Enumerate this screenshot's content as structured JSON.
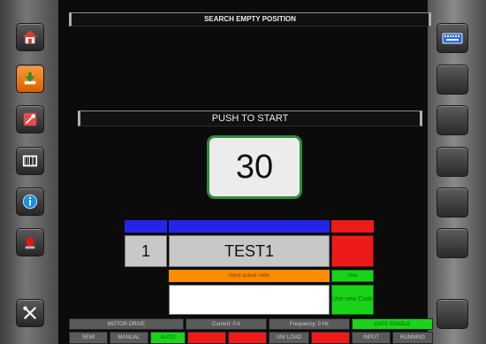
{
  "header": {
    "title": "SEARCH EMPTY POSITION"
  },
  "push": {
    "label": "PUSH TO START"
  },
  "counter": {
    "value": "30"
  },
  "code_panel": {
    "position_header": "",
    "code_header": "",
    "red_header": "",
    "position_value": "1",
    "code_value": "TEST1",
    "red_button": "",
    "input_prompt": "Input actual code",
    "input_value": "",
    "use_button": "Use",
    "use_new_code_button": "Use new Code"
  },
  "status_row1": {
    "motor_drive": "MOTOR DRIVE",
    "current": "Current: 0 A",
    "frequency": "Frequency: 0 Hz",
    "gate_enable": "GATE ENABLE"
  },
  "status_row2": {
    "semi": "SEMI",
    "manual": "MANUAL",
    "auto": "AUTO",
    "red1": "",
    "red2": "",
    "unload": "UN/ LOAD",
    "red3": "",
    "input": "INPUT",
    "running": "RUNNING"
  },
  "left_nav": [
    "home-icon",
    "download-icon",
    "tools-icon",
    "barcode-icon",
    "info-icon",
    "alarm-light-icon",
    "settings-tools-icon"
  ],
  "colors": {
    "accent_green": "#1ad31a",
    "accent_red": "#ee1a1a",
    "accent_blue": "#2424e8",
    "accent_orange": "#ff8c00",
    "active_nav": "#ff8a00"
  }
}
